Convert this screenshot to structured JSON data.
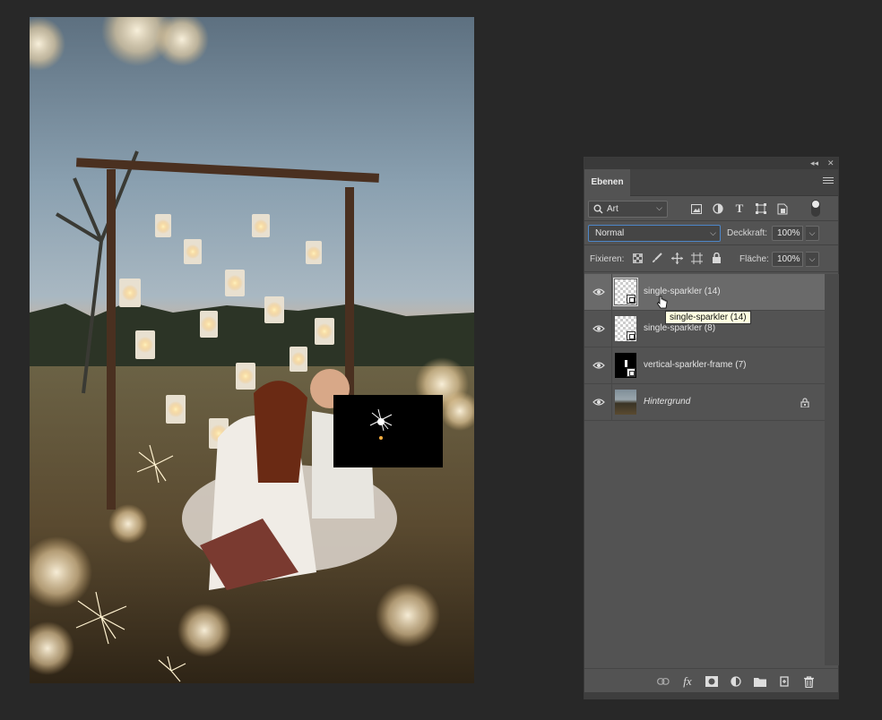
{
  "panel": {
    "tab_label": "Ebenen",
    "filter": {
      "kind_label": "Art"
    },
    "blend_mode": "Normal",
    "opacity_label": "Deckkraft:",
    "opacity_value": "100%",
    "lock_label": "Fixieren:",
    "fill_label": "Fläche:",
    "fill_value": "100%"
  },
  "layers": [
    {
      "name": "single-sparkler (14)",
      "selected": true
    },
    {
      "name": "single-sparkler (8)",
      "selected": false
    },
    {
      "name": "vertical-sparkler-frame (7)",
      "selected": false
    },
    {
      "name": "Hintergrund",
      "selected": false,
      "locked": true
    }
  ],
  "tooltip": "single-sparkler (14)",
  "colors": {
    "panel_bg": "#535353",
    "selected_row": "#6a6a6a",
    "workspace": "#282828",
    "tooltip_bg": "#ffffe1"
  }
}
